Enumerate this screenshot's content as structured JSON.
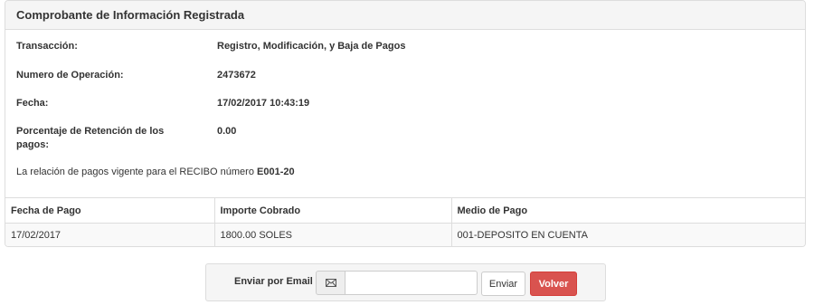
{
  "panel": {
    "title": "Comprobante de Información Registrada"
  },
  "info": [
    {
      "label": "Transacción:",
      "value": "Registro, Modificación, y Baja de Pagos"
    },
    {
      "label": "Numero de Operación:",
      "value": "2473672"
    },
    {
      "label": "Fecha:",
      "value": "17/02/2017 10:43:19"
    },
    {
      "label": "Porcentaje de Retención de los pagos:",
      "value": "0.00"
    }
  ],
  "note": {
    "text": "La relación de pagos vigente para el RECIBO número",
    "receipt": "E001-20"
  },
  "table": {
    "headers": [
      "Fecha de Pago",
      "Importe Cobrado",
      "Medio de Pago"
    ],
    "rows": [
      [
        "17/02/2017",
        "1800.00 SOLES",
        "001-DEPOSITO EN CUENTA"
      ]
    ]
  },
  "email": {
    "label": "Enviar por Email",
    "icon": "envelope-icon",
    "input_value": "",
    "send_label": "Enviar",
    "back_label": "Volver"
  },
  "colors": {
    "heading_bg": "#f5f5f5",
    "border": "#dddddd",
    "danger": "#d9534f"
  }
}
